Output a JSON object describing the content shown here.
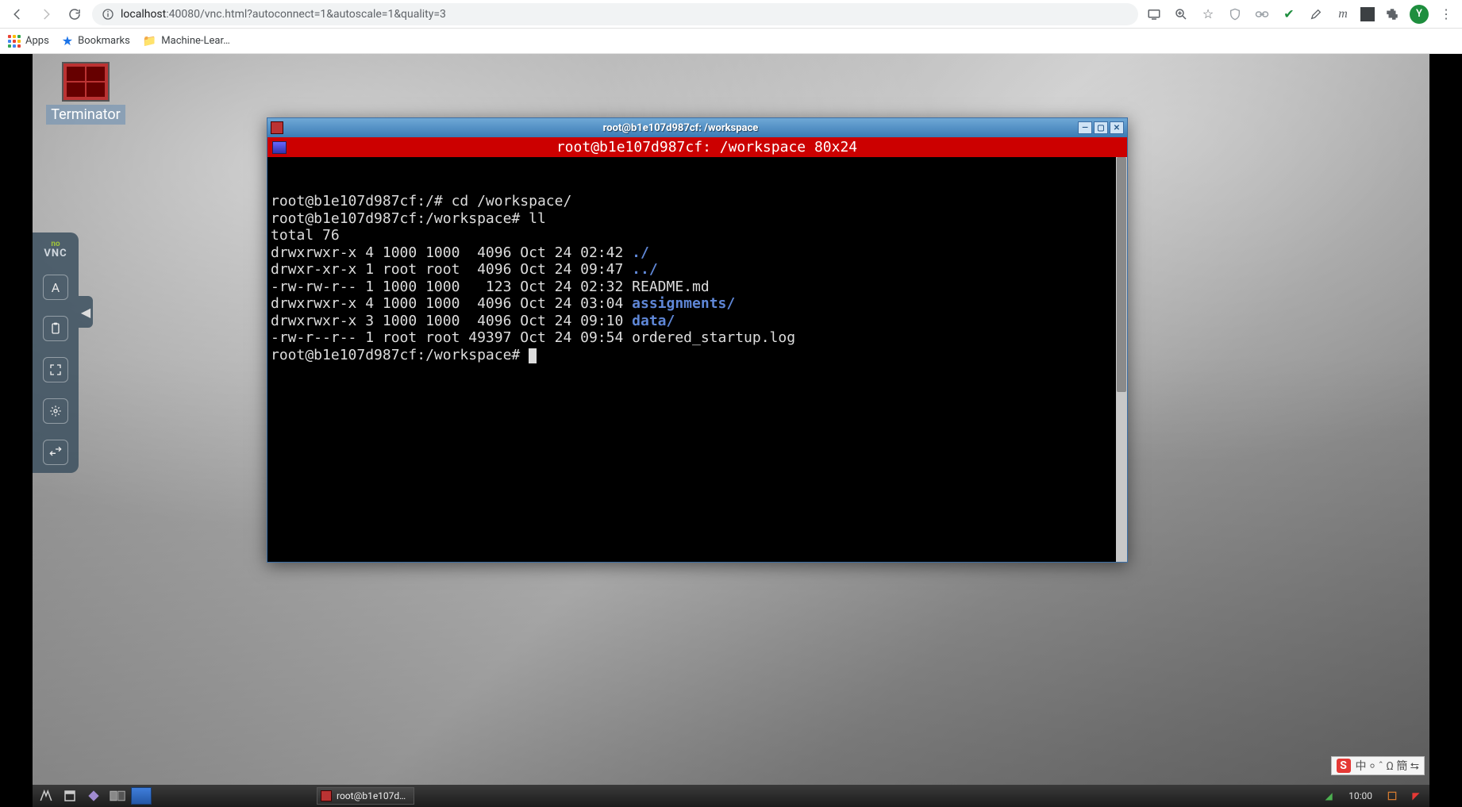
{
  "browser": {
    "url_host": "localhost",
    "url_port": ":40080",
    "url_path": "/vnc.html?autoconnect=1&autoscale=1&quality=3",
    "avatar_initial": "Y"
  },
  "bookmarks": {
    "apps": "Apps",
    "bookmarks": "Bookmarks",
    "ml": "Machine-Lear…"
  },
  "desktop": {
    "terminator_label": "Terminator"
  },
  "terminal": {
    "window_title": "root@b1e107d987cf: /workspace",
    "tab_title": "root@b1e107d987cf: /workspace 80x24",
    "lines": [
      {
        "text": "root@b1e107d987cf:/# cd /workspace/"
      },
      {
        "text": "root@b1e107d987cf:/workspace# ll"
      },
      {
        "text": "total 76"
      },
      {
        "prefix": "drwxrwxr-x 4 1000 1000  4096 Oct 24 02:42 ",
        "dir": "./"
      },
      {
        "prefix": "drwxr-xr-x 1 root root  4096 Oct 24 09:47 ",
        "dir": "../"
      },
      {
        "text": "-rw-rw-r-- 1 1000 1000   123 Oct 24 02:32 README.md"
      },
      {
        "prefix": "drwxrwxr-x 4 1000 1000  4096 Oct 24 03:04 ",
        "dir": "assignments/"
      },
      {
        "prefix": "drwxrwxr-x 3 1000 1000  4096 Oct 24 09:10 ",
        "dir": "data/"
      },
      {
        "text": "-rw-r--r-- 1 root root 49397 Oct 24 09:54 ordered_startup.log"
      },
      {
        "prompt": "root@b1e107d987cf:/workspace# "
      }
    ]
  },
  "taskbar": {
    "task_label": "root@b1e107d…",
    "clock": "10:00"
  },
  "ime": {
    "chars": "中 ⸰ ˆ Ω 簡 ⮀"
  }
}
